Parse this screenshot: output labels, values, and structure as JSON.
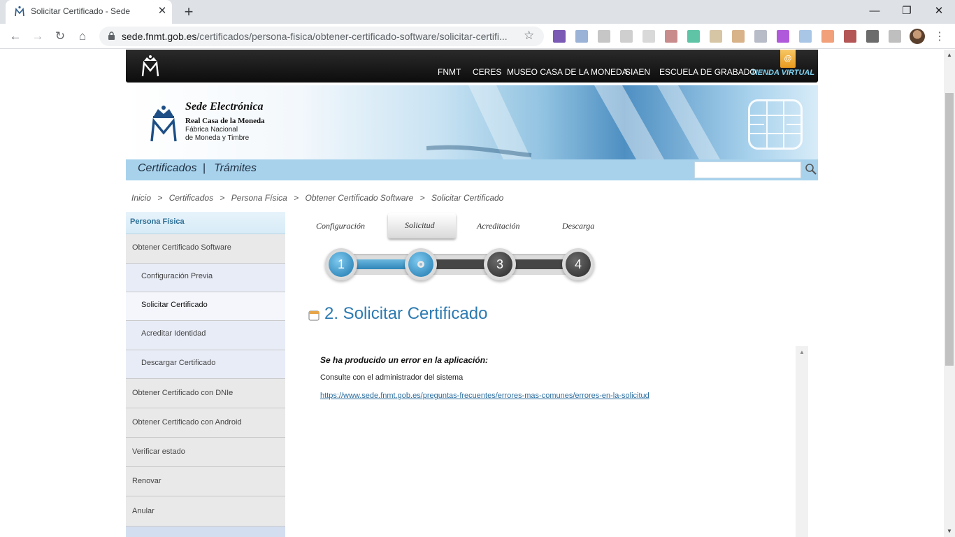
{
  "browser": {
    "tab_title": "Solicitar Certificado - Sede",
    "url_host": "sede.fnmt.gob.es",
    "url_path": "/certificados/persona-fisica/obtener-certificado-software/solicitar-certifi...",
    "new_tab": "+",
    "close": "✕",
    "minimize": "—",
    "restore": "❐",
    "win_close": "✕",
    "back": "←",
    "forward": "→",
    "reload": "↻",
    "home": "⌂",
    "star": "☆",
    "menu": "⋮"
  },
  "topnav": {
    "items": [
      "FNMT",
      "CERES",
      "MUSEO CASA DE LA MONEDA",
      "SIAEN",
      "ESCUELA DE GRABADO"
    ],
    "tienda": "TIENDA VIRTUAL",
    "bag_symbol": "@"
  },
  "banner": {
    "title": "Sede Electrónica",
    "line1": "Real Casa de la Moneda",
    "line2": "Fábrica Nacional",
    "line3": "de Moneda y Timbre"
  },
  "subnav": {
    "certificados": "Certificados",
    "sep": "|",
    "tramites": "Trámites"
  },
  "breadcrumb": {
    "items": [
      "Inicio",
      ">",
      "Certificados",
      ">",
      "Persona Física",
      ">",
      "Obtener Certificado Software",
      ">",
      " Solicitar Certificado"
    ]
  },
  "sidebar": {
    "header": "Persona Física",
    "items": [
      "Obtener Certificado Software",
      "Configuración Previa",
      "Solicitar Certificado",
      "Acreditar Identidad",
      "Descargar Certificado",
      "Obtener Certificado con DNIe",
      "Obtener Certificado con Android",
      "Verificar estado",
      "Renovar",
      "Anular"
    ]
  },
  "steps": {
    "labels": [
      "Configuración",
      "Solicitud",
      "Acreditación",
      "Descarga"
    ],
    "numbers": [
      "1",
      "",
      "3",
      "4"
    ]
  },
  "main": {
    "title": "2. Solicitar Certificado",
    "error_title": "Se ha producido un error en la aplicación:",
    "error_text": "Consulte con el administrador del sistema",
    "error_link": "https://www.sede.fnmt.gob.es/preguntas-frecuentes/errores-mas-comunes/errores-en-la-solicitud"
  },
  "colors": {
    "accent_blue": "#2b7ab1",
    "topnav_bg": "#111111",
    "subnav_bg": "#a8d2ec",
    "tienda": "#7fd0ee"
  }
}
